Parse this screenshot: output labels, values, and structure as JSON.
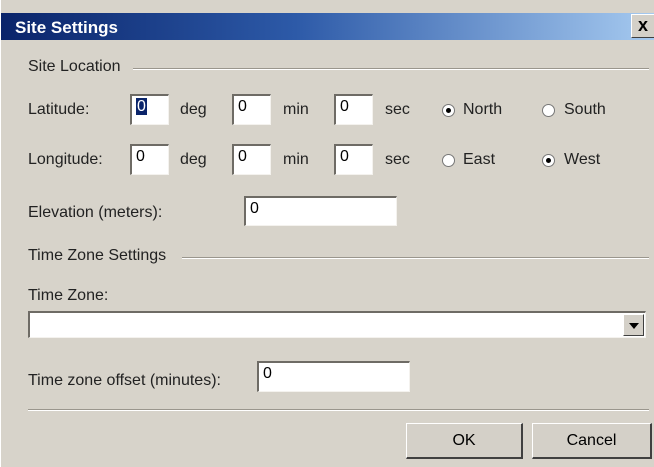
{
  "window": {
    "title": "Site Settings",
    "close_label": "x"
  },
  "site_location": {
    "section_label": "Site Location",
    "latitude": {
      "label": "Latitude:",
      "deg": "0",
      "min": "0",
      "sec": "0",
      "deg_unit": "deg",
      "min_unit": "min",
      "sec_unit": "sec",
      "option_a": "North",
      "option_b": "South",
      "selected": "North"
    },
    "longitude": {
      "label": "Longitude:",
      "deg": "0",
      "min": "0",
      "sec": "0",
      "deg_unit": "deg",
      "min_unit": "min",
      "sec_unit": "sec",
      "option_a": "East",
      "option_b": "West",
      "selected": "West"
    },
    "elevation": {
      "label": "Elevation (meters):",
      "value": "0"
    }
  },
  "time_zone_settings": {
    "section_label": "Time Zone Settings",
    "time_zone": {
      "label": "Time Zone:",
      "value": ""
    },
    "offset": {
      "label": "Time zone offset (minutes):",
      "value": "0"
    }
  },
  "buttons": {
    "ok": "OK",
    "cancel": "Cancel"
  }
}
